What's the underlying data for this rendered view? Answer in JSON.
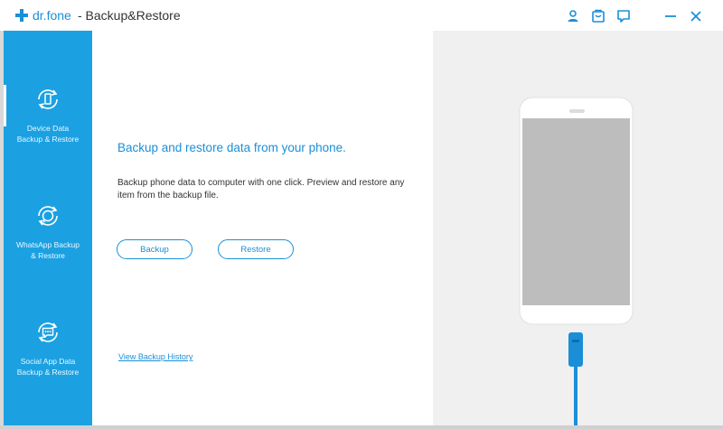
{
  "titlebar": {
    "brand": "dr.fone",
    "title": "- Backup&Restore",
    "icons": [
      "account-icon",
      "cart-icon",
      "feedback-icon",
      "minimize-icon",
      "close-icon"
    ]
  },
  "colors": {
    "accent": "#1a8fd8",
    "sidebar": "#1ba1e2",
    "panel": "#f0f0f0",
    "phone_screen": "#bdbdbd"
  },
  "sidebar": {
    "items": [
      {
        "label_line1": "Device Data",
        "label_line2": "Backup & Restore",
        "icon": "device-backup-icon",
        "active": true
      },
      {
        "label_line1": "WhatsApp Backup",
        "label_line2": "& Restore",
        "icon": "whatsapp-backup-icon",
        "active": false
      },
      {
        "label_line1": "Social App Data",
        "label_line2": "Backup & Restore",
        "icon": "social-backup-icon",
        "active": false
      }
    ]
  },
  "main": {
    "headline": "Backup and restore data from your phone.",
    "description": "Backup phone data to computer with one click. Preview and restore any item from the backup file.",
    "backup_label": "Backup",
    "restore_label": "Restore",
    "history_link": "View Backup History"
  }
}
